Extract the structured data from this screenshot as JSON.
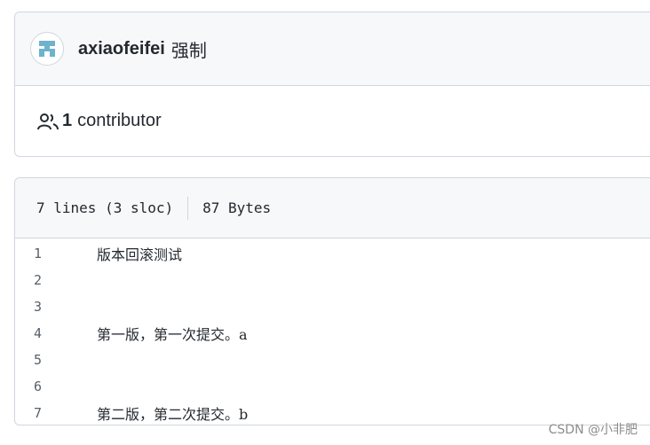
{
  "commit": {
    "author": "axiaofeifei",
    "message": "强制",
    "avatar_icon": "pixel-identicon"
  },
  "contributors": {
    "icon": "people-icon",
    "count": "1",
    "label": "contributor"
  },
  "file": {
    "lines_info": "7 lines (3 sloc)",
    "size": "87 Bytes",
    "lines": [
      {
        "num": "1",
        "text": "版本回滚测试"
      },
      {
        "num": "2",
        "text": ""
      },
      {
        "num": "3",
        "text": ""
      },
      {
        "num": "4",
        "text": "第一版，第一次提交。a"
      },
      {
        "num": "5",
        "text": ""
      },
      {
        "num": "6",
        "text": ""
      },
      {
        "num": "7",
        "text": "第二版，第二次提交。b"
      }
    ]
  },
  "watermark": "CSDN @小非肥",
  "colors": {
    "border": "#d0d7de",
    "header_bg": "#f6f8fa",
    "avatar": "#6fb2cd"
  }
}
